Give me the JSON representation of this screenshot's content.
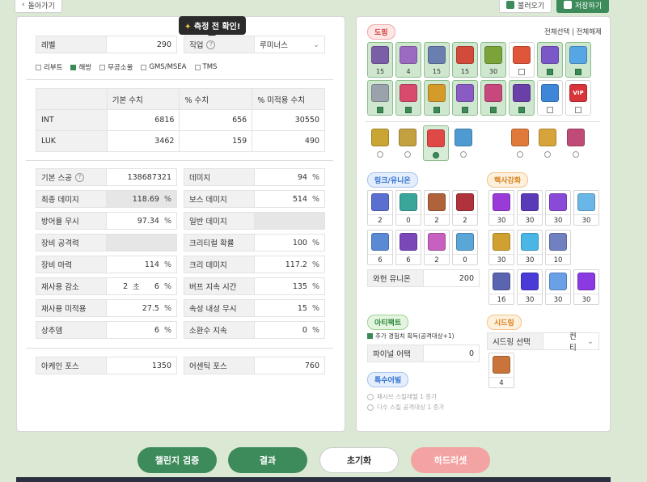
{
  "top": {
    "back_label": "돌아가기",
    "load_label": "불러오기",
    "save_label": "저장하기"
  },
  "tooltip": {
    "text": "측정 전 확인!"
  },
  "left": {
    "level_label": "레벨",
    "level_value": "290",
    "job_label": "직업",
    "job_value": "루미너스",
    "servers": [
      {
        "label": "리부트",
        "checked": false
      },
      {
        "label": "해방",
        "checked": true
      },
      {
        "label": "무공소울",
        "checked": false
      },
      {
        "label": "GMS/MSEA",
        "checked": false
      },
      {
        "label": "TMS",
        "checked": false
      }
    ],
    "stat_headers": [
      "",
      "기본 수치",
      "% 수치",
      "% 미적용 수치"
    ],
    "stat_rows": [
      [
        "INT",
        "6816",
        "656",
        "30550"
      ],
      [
        "LUK",
        "3462",
        "159",
        "490"
      ]
    ],
    "fields": {
      "base_scouter": {
        "label": "기본 스공",
        "value": "138687321"
      },
      "damage": {
        "label": "데미지",
        "value": "94",
        "unit": "%"
      },
      "final_damage": {
        "label": "최종 데미지",
        "value": "118.69",
        "unit": "%"
      },
      "boss_damage": {
        "label": "보스 데미지",
        "value": "514",
        "unit": "%"
      },
      "ignore_def": {
        "label": "방어율 무시",
        "value": "97.34",
        "unit": "%"
      },
      "normal_damage": {
        "label": "일반 데미지"
      },
      "equip_attack": {
        "label": "장비 공격력"
      },
      "crit_rate": {
        "label": "크리티컬 확률",
        "value": "100",
        "unit": "%"
      },
      "equip_magic": {
        "label": "장비 마력",
        "value": "114",
        "unit": "%"
      },
      "crit_damage": {
        "label": "크리 데미지",
        "value": "117.2",
        "unit": "%"
      },
      "cooldown": {
        "label": "재사용 감소",
        "value_sec": "2",
        "sec_unit": "초",
        "value_pct": "6",
        "unit": "%"
      },
      "buff_duration": {
        "label": "버프 지속 시간",
        "value": "135",
        "unit": "%"
      },
      "cooldown_unapplied": {
        "label": "재사용 미적용",
        "value": "27.5",
        "unit": "%"
      },
      "ignore_elem": {
        "label": "속성 내성 무시",
        "value": "15",
        "unit": "%"
      },
      "status_dmg": {
        "label": "상추뎀",
        "value": "6",
        "unit": "%"
      },
      "summon_duration": {
        "label": "소환수 지속",
        "value": "0",
        "unit": "%"
      }
    },
    "arcane_label": "아케인 포스",
    "arcane_value": "1350",
    "authentic_label": "어센틱 포스",
    "authentic_value": "760"
  },
  "right": {
    "doping_tag": "도핑",
    "select_all": "전체선택",
    "separator": "|",
    "deselect_all": "전체해제",
    "doping_row1": [
      {
        "count": "15",
        "color": "#7b5ea8",
        "on": true
      },
      {
        "count": "4",
        "color": "#9b6bc1",
        "on": true
      },
      {
        "count": "15",
        "color": "#6a7fb0",
        "on": true
      },
      {
        "count": "15",
        "color": "#d24b3a",
        "on": true
      },
      {
        "count": "30",
        "color": "#7aa43a",
        "on": true
      },
      {
        "count": "",
        "color": "#e0563b",
        "on": false
      },
      {
        "count": "",
        "color": "#7b58c8",
        "on": true
      },
      {
        "count": "",
        "color": "#56a6e6",
        "on": true
      }
    ],
    "doping_row2": [
      {
        "color": "#9aa3ab",
        "on": true
      },
      {
        "color": "#d84b6c",
        "on": true
      },
      {
        "color": "#d49a2a",
        "on": true
      },
      {
        "color": "#8a5bc2",
        "on": true
      },
      {
        "color": "#c7487c",
        "on": true
      },
      {
        "color": "#6a3fa8",
        "on": true
      },
      {
        "color": "#3d86d8",
        "on": false
      },
      {
        "color": "#d8343a",
        "on": false,
        "label": "VIP"
      }
    ],
    "small_icons": [
      {
        "color": "#c9a634",
        "on": false
      },
      {
        "color": "#c3a040",
        "on": false
      },
      {
        "color": "#e04848",
        "on": true
      },
      {
        "color": "#4f9ad1",
        "on": false
      },
      {
        "color": "#e07a3a",
        "on": false
      },
      {
        "color": "#d6a43a",
        "on": false
      },
      {
        "color": "#c04a78",
        "on": false
      }
    ],
    "link_tag": "링크/유니온",
    "links": [
      {
        "count": "2",
        "color": "#5b6fd0"
      },
      {
        "count": "0",
        "color": "#3aa59b"
      },
      {
        "count": "2",
        "color": "#b0623a"
      },
      {
        "count": "2",
        "color": "#b0323a"
      },
      {
        "count": "6",
        "color": "#5a8ad6"
      },
      {
        "count": "6",
        "color": "#7a48b8"
      },
      {
        "count": "2",
        "color": "#c860c0"
      },
      {
        "count": "0",
        "color": "#5aa6d6"
      }
    ],
    "union_label": "와헌 유니온",
    "union_value": "200",
    "core_tag": "핵사강화",
    "cores": [
      {
        "count": "30",
        "color": "#9a3ad8"
      },
      {
        "count": "30",
        "color": "#5a3ab8"
      },
      {
        "count": "30",
        "color": "#8a4ad8"
      },
      {
        "count": "30",
        "color": "#6ab6e6"
      },
      {
        "count": "30",
        "color": "#d0a030"
      },
      {
        "count": "30",
        "color": "#4ab6e6"
      },
      {
        "count": "10",
        "color": "#7080c0"
      },
      {
        "count": "16",
        "color": "#5a64b0"
      },
      {
        "count": "30",
        "color": "#4a3ad8"
      },
      {
        "count": "30",
        "color": "#6aa0e6"
      },
      {
        "count": "30",
        "color": "#8a3ae0"
      }
    ],
    "artifact_tag": "아티팩트",
    "artifact_option": "추가 경험치 획득(공격대상+1)",
    "final_attack_label": "파이널 어택",
    "final_attack_value": "0",
    "seed_tag": "시드링",
    "seed_label": "시드링 선택",
    "seed_value": "컨티",
    "seed_icon_color": "#c9743a",
    "seed_count": "4",
    "special_tag": "특수어빌",
    "special_options": [
      "패시브 스킬레벨 1 증가",
      "다수 스킬 공격대상 1 증가"
    ]
  },
  "bottom": {
    "challenger_label": "챌린지 검증",
    "result_label": "결과",
    "reset_label": "초기화",
    "hard_reset_label": "하드리셋"
  },
  "colors": {
    "green": "#3d8a5a",
    "red_btn": "#f4a3a3"
  }
}
